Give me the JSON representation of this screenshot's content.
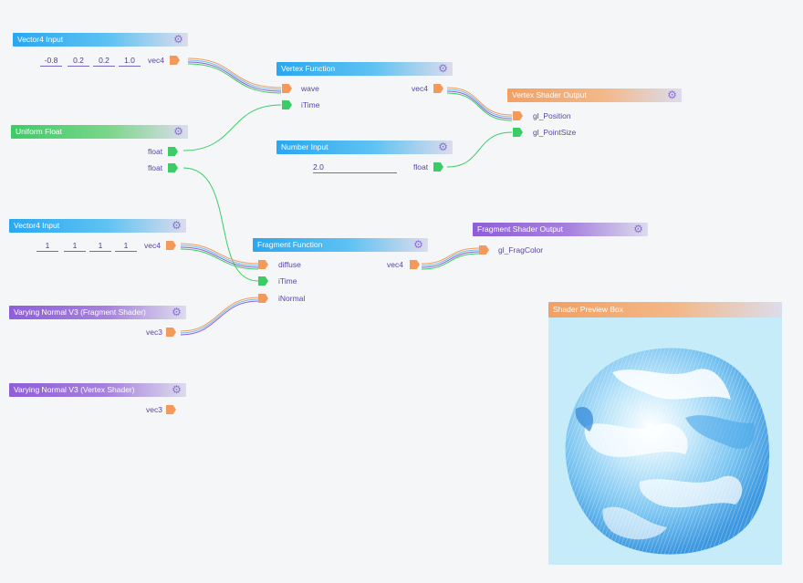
{
  "nodes": {
    "vec4_input_1": {
      "title": "Vector4 Input",
      "values": [
        "-0.8",
        "0.2",
        "0.2",
        "1.0"
      ],
      "out": "vec4"
    },
    "uniform_float": {
      "title": "Uniform Float",
      "outs": [
        "float",
        "float"
      ]
    },
    "vec4_input_2": {
      "title": "Vector4 Input",
      "values": [
        "1",
        "1",
        "1",
        "1"
      ],
      "out": "vec4"
    },
    "varying_normal_frag": {
      "title": "Varying Normal V3 (Fragment Shader)",
      "out": "vec3"
    },
    "varying_normal_vert": {
      "title": "Varying Normal V3 (Vertex Shader)",
      "out": "vec3"
    },
    "vertex_function": {
      "title": "Vertex Function",
      "ins": [
        "wave",
        "iTime"
      ],
      "out": "vec4"
    },
    "number_input": {
      "title": "Number Input",
      "value": "2.0",
      "out": "float"
    },
    "vertex_shader_output": {
      "title": "Vertex Shader Output",
      "ins": [
        "gl_Position",
        "gl_PointSize"
      ]
    },
    "fragment_function": {
      "title": "Fragment Function",
      "ins": [
        "diffuse",
        "iTime",
        "iNormal"
      ],
      "out": "vec4"
    },
    "fragment_shader_output": {
      "title": "Fragment Shader Output",
      "ins": [
        "gl_FragColor"
      ]
    },
    "preview": {
      "title": "Shader Preview Box"
    }
  },
  "colors": {
    "blue": "#2aa7f0",
    "green": "#3ccc65",
    "purple": "#8e5ed8",
    "orange": "#f2a063",
    "port_orange": "#f39a5a",
    "label": "#5b45a5"
  },
  "icons": {
    "settings": "gear-icon"
  }
}
